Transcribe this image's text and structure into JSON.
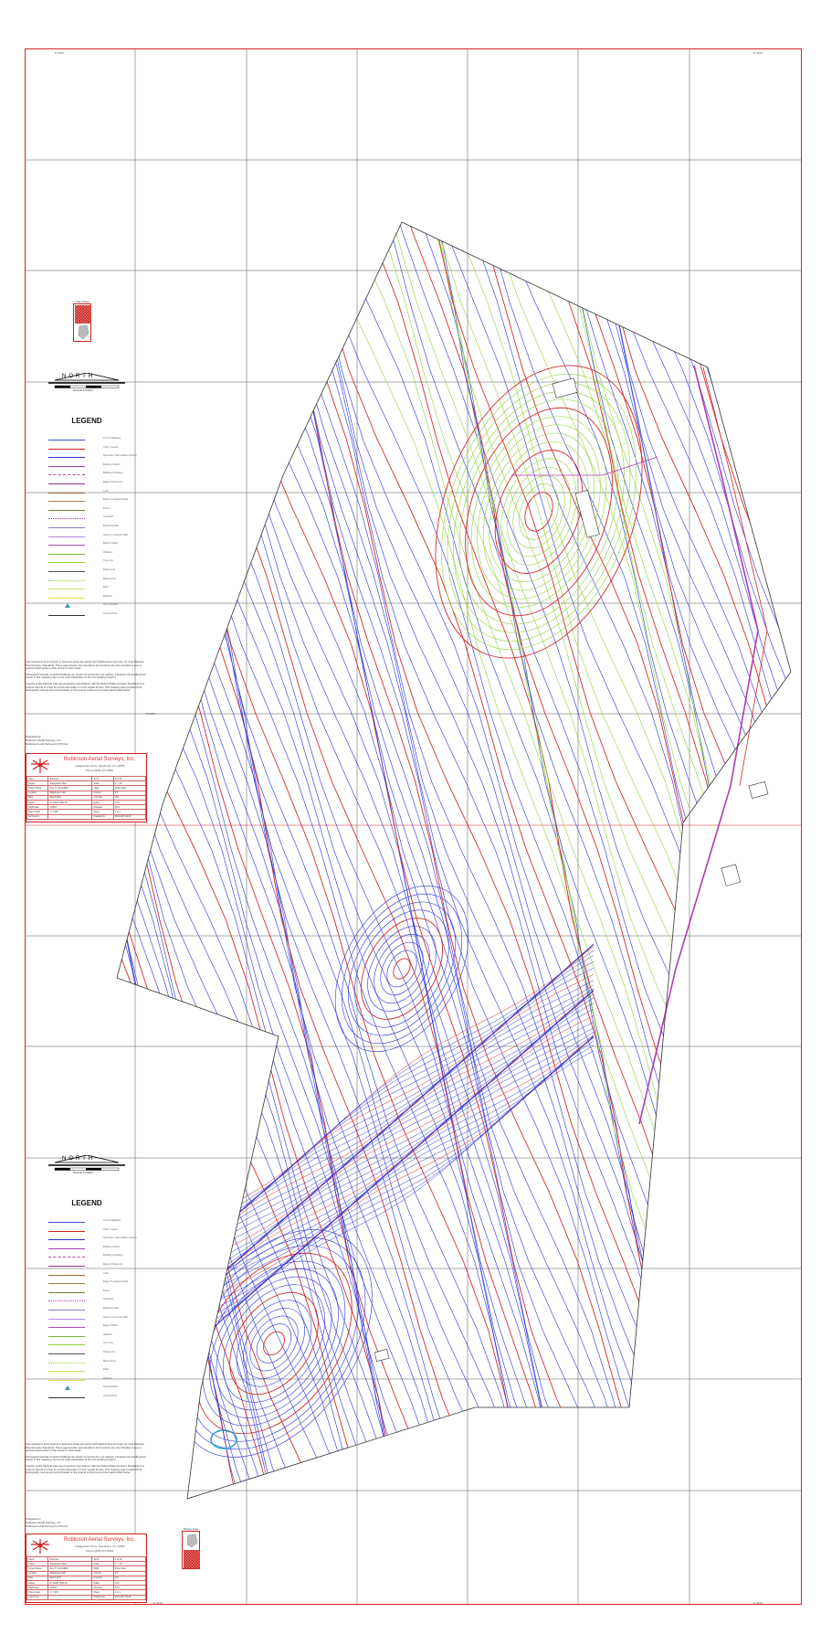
{
  "sheet": {
    "grid_labels_top": [
      "N 1000",
      "E 1000"
    ],
    "grid_labels_bottom": [
      "E 1000",
      "E 1000"
    ],
    "grid_label_mid": "N 1000"
  },
  "key_map": {
    "label_top": "Index Maps",
    "label_bottom": "Master Area"
  },
  "north_arrow": {
    "text": "NORTH",
    "scale_label": "SCALE IN FEET"
  },
  "legend": {
    "title": "LEGEND",
    "items": [
      {
        "label": "Limit of Mapping",
        "color": "#3a4fd8",
        "style": "solid"
      },
      {
        "label": "Index Contour",
        "color": "#d32020",
        "style": "solid"
      },
      {
        "label": "Spot Elev. Intermediate Contour",
        "color": "#2b36c9",
        "style": "solid"
      },
      {
        "label": "Building Outline",
        "color": "#9a3fa8",
        "style": "solid"
      },
      {
        "label": "Building Overhang",
        "color": "#b04da0",
        "style": "dashed"
      },
      {
        "label": "Edge of Pavement",
        "color": "#8a3d8a",
        "style": "solid"
      },
      {
        "label": "Curb",
        "color": "#9b6a3a",
        "style": "solid"
      },
      {
        "label": "Edge of Unpaved Road",
        "color": "#a17b4b",
        "style": "solid"
      },
      {
        "label": "Fence",
        "color": "#7a7a3a",
        "style": "solid"
      },
      {
        "label": "Guardrail",
        "color": "#b03aa8",
        "style": "dotted"
      },
      {
        "label": "Retaining Wall",
        "color": "#8e7cc3",
        "style": "solid"
      },
      {
        "label": "Stone or Concrete Wall",
        "color": "#b28ce0",
        "style": "solid"
      },
      {
        "label": "Edge of Water",
        "color": "#a550b4",
        "style": "solid"
      },
      {
        "label": "Wetland",
        "color": "#7ab83a",
        "style": "solid"
      },
      {
        "label": "Tree Line",
        "color": "#8fd23c",
        "style": "solid"
      },
      {
        "label": "Power Line",
        "color": "#555555",
        "style": "solid"
      },
      {
        "label": "Marsh Area",
        "color": "#8ad43c",
        "style": "dotted"
      },
      {
        "label": "Ditch",
        "color": "#c4e06a",
        "style": "solid"
      },
      {
        "label": "Railroad",
        "color": "#e8e04a",
        "style": "solid"
      },
      {
        "label": "Spot Elevation",
        "color": "#3aa0a0",
        "style": "marker"
      },
      {
        "label": "Control Point",
        "color": "#333333",
        "style": "solid"
      }
    ]
  },
  "notes": {
    "paragraph_1": "Spot elevations and contours in obscured areas are shown with dashed lines and may not meet National Map Accuracy Standards. These approximate spot elevations and contours are only intended to give a general interpretation of the terrain in such areas.",
    "paragraph_2": "Photogrammetrically compiled buildings are shown by tracing the roof outlines. Therefore the building lines shown in this mapping may not be exact duplication of the true building footprint.",
    "paragraph_3": "I hereby certify that this map was prepared in accordance with the National Map Accuracy Standards to a contour interval of 2 feet at a horizontal scale of 1 inch equals 40 feet. This mapping was compiled from photography and ground control based on the ground control survey information listed below.",
    "prepared_line_1": "Prepared by:",
    "prepared_line_2": "Robinson Aerial Surveys, Inc.",
    "prepared_line_3": "Robinson Land Surveyors NYS Lic."
  },
  "title_block": {
    "company": "Robinson Aerial Surveys, Inc.",
    "address": "1 Edgewater Drive, Newburgh, NY 12550",
    "phone": "Phone (845) 471-8000",
    "rows": [
      [
        "Client",
        "Robinson",
        "Job #",
        "5 of 58"
      ],
      [
        "Project",
        "Topographic Map",
        "Scale",
        "1\" = 40'"
      ],
      [
        "Project Name",
        "DAL TY 60 ACRES",
        "Flight",
        "Photo Date"
      ],
      [
        "Location",
        "Wappinger Falls",
        "Contour",
        "2 ft"
      ],
      [
        "Date",
        "March 2017",
        "Compiler",
        "JLS"
      ],
      [
        "Datum",
        "NY EAST NAD 83",
        "Editor",
        "CTC"
      ],
      [
        "Flight Date",
        "4/18/17",
        "Checked",
        "KHS"
      ],
      [
        "Photo Scale",
        "1\" = 300'",
        "Sheet",
        "1 of 1"
      ],
      [
        "Comments",
        "",
        "Drawing No.",
        "RAS-2017-0418"
      ]
    ]
  },
  "map": {
    "colors": {
      "intermediate_contour": "#2b36d6",
      "index_contour": "#d42a2a",
      "wooded_contour": "#8fd43a",
      "magenta_feature": "#b23ab5",
      "boundary": "#333333",
      "grid": "#555555",
      "frame": "#d22222"
    }
  }
}
